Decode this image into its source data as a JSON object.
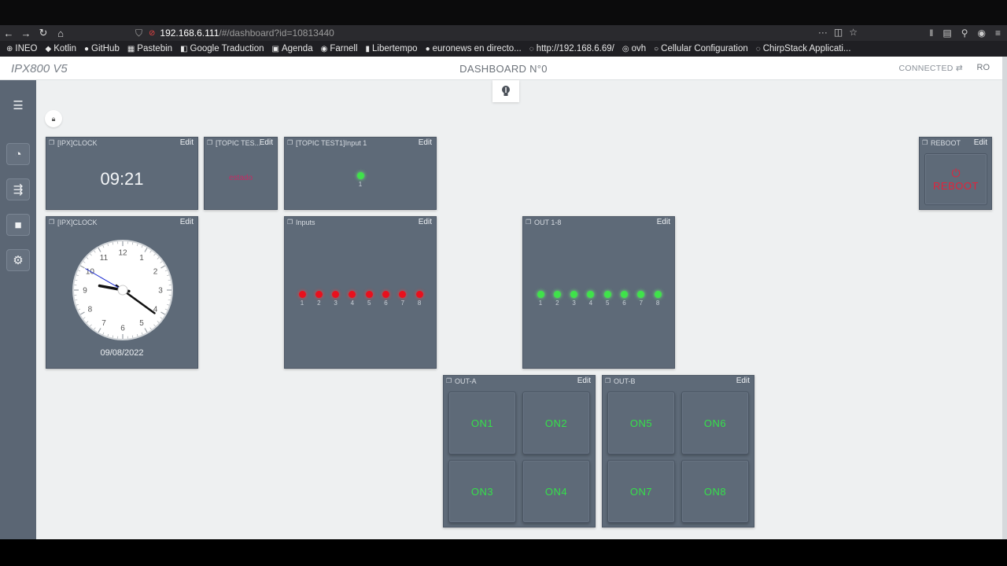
{
  "browser": {
    "url_host": "192.168.6.111",
    "url_rest": "/#/dashboard?id=10813440",
    "bookmarks": [
      {
        "icon": "globe-icon",
        "label": "INEO"
      },
      {
        "icon": "kotlin-icon",
        "label": "Kotlin"
      },
      {
        "icon": "github-icon",
        "label": "GitHub"
      },
      {
        "icon": "pastebin-icon",
        "label": "Pastebin"
      },
      {
        "icon": "google-translate-icon",
        "label": "Google  Traduction"
      },
      {
        "icon": "calendar-icon",
        "label": "Agenda"
      },
      {
        "icon": "farnell-icon",
        "label": "Farnell"
      },
      {
        "icon": "libertempo-icon",
        "label": "Libertempo"
      },
      {
        "icon": "euronews-icon",
        "label": "euronews en directo..."
      },
      {
        "icon": "page-icon",
        "label": "http://192.168.6.69/"
      },
      {
        "icon": "ovh-icon",
        "label": "ovh"
      },
      {
        "icon": "cellular-icon",
        "label": "Cellular Configuration"
      },
      {
        "icon": "chirpstack-icon",
        "label": "ChirpStack Applicati..."
      }
    ]
  },
  "app": {
    "brand": "IPX800 V5",
    "dashboard_title": "DASHBOARD N°0",
    "connection_status": "CONNECTED",
    "user": "RO"
  },
  "widgets": {
    "clock_digital": {
      "title": "[IPX]CLOCK",
      "edit": "Edit",
      "time": "09:21"
    },
    "topic_test": {
      "title": "[TOPIC TES...",
      "edit": "Edit",
      "value": "estado"
    },
    "topic_input": {
      "title": "[TOPIC TEST1]Input 1",
      "edit": "Edit",
      "led_label": "1",
      "led_on": true
    },
    "clock_analog": {
      "title": "[IPX]CLOCK",
      "edit": "Edit",
      "date": "09/08/2022",
      "numbers": [
        "12",
        "1",
        "2",
        "3",
        "4",
        "5",
        "6",
        "7",
        "8",
        "9",
        "10",
        "11"
      ],
      "time": "09:21"
    },
    "inputs": {
      "title": "Inputs",
      "edit": "Edit",
      "labels": [
        "1",
        "2",
        "3",
        "4",
        "5",
        "6",
        "7",
        "8"
      ],
      "states": [
        false,
        false,
        false,
        false,
        false,
        false,
        false,
        false
      ]
    },
    "out18": {
      "title": "OUT 1-8",
      "edit": "Edit",
      "labels": [
        "1",
        "2",
        "3",
        "4",
        "5",
        "6",
        "7",
        "8"
      ],
      "states": [
        true,
        true,
        true,
        true,
        true,
        true,
        true,
        true
      ]
    },
    "out_a": {
      "title": "OUT-A",
      "edit": "Edit",
      "buttons": [
        "ON1",
        "ON2",
        "ON3",
        "ON4"
      ]
    },
    "out_b": {
      "title": "OUT-B",
      "edit": "Edit",
      "buttons": [
        "ON5",
        "ON6",
        "ON7",
        "ON8"
      ]
    },
    "reboot": {
      "title": "REBOOT",
      "edit": "Edit",
      "button": "REBOOT"
    }
  },
  "colors": {
    "widget_bg": "#5e6a78",
    "led_on": "#3fe34a",
    "led_off": "#e8101d",
    "switch_text": "#35e04a",
    "reboot_red": "#e3223b"
  }
}
